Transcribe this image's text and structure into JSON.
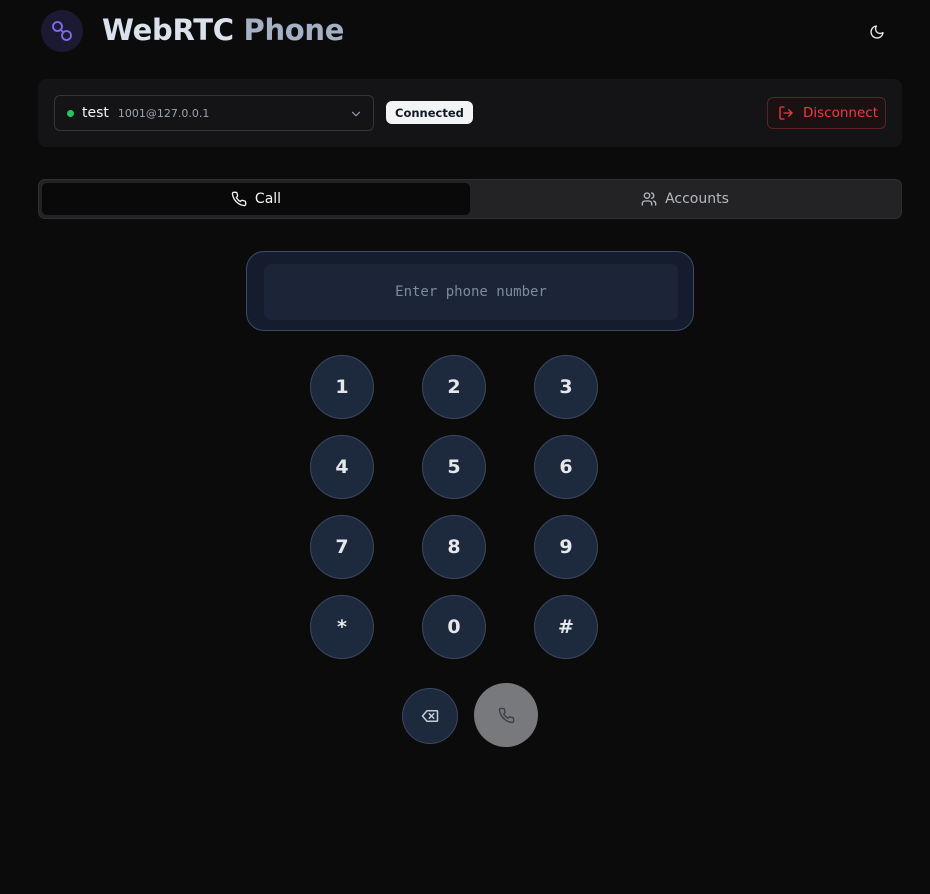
{
  "header": {
    "title_part1": "WebRTC",
    "title_part2": "Phone",
    "logo_icon": "link-rings-icon",
    "theme_toggle_icon": "moon-icon"
  },
  "account_bar": {
    "selected_account": {
      "name": "test",
      "uri": "1001@127.0.0.1",
      "status_color": "#22c55e"
    },
    "status_badge": "Connected",
    "disconnect_label": "Disconnect"
  },
  "tabs": [
    {
      "label": "Call",
      "icon": "phone-icon",
      "active": true
    },
    {
      "label": "Accounts",
      "icon": "users-icon",
      "active": false
    }
  ],
  "dialer": {
    "placeholder": "Enter phone number",
    "value": "",
    "keys": [
      "1",
      "2",
      "3",
      "4",
      "5",
      "6",
      "7",
      "8",
      "9",
      "*",
      "0",
      "#"
    ],
    "backspace_icon": "backspace-icon",
    "call_icon": "phone-icon"
  },
  "colors": {
    "accent_danger": "#ef3b3b",
    "connected": "#22c55e",
    "key_bg": "#1d293d"
  }
}
